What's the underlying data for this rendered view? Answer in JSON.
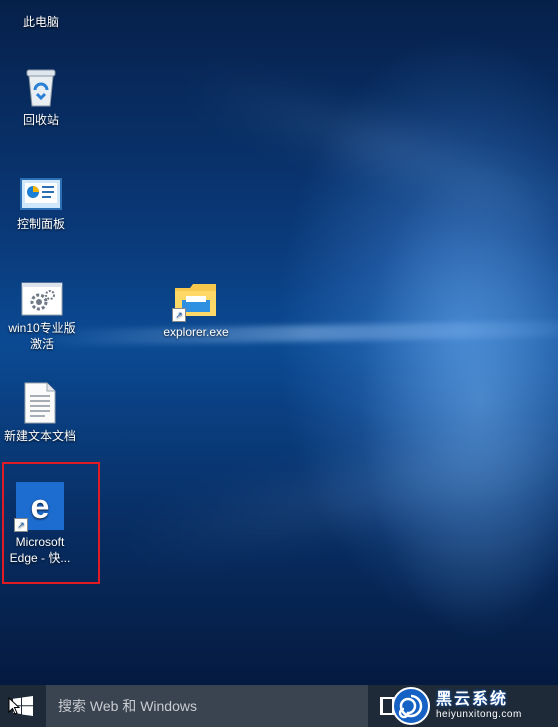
{
  "desktop": {
    "icons": [
      {
        "name": "this-pc",
        "label": "此电脑"
      },
      {
        "name": "recycle-bin",
        "label": "回收站"
      },
      {
        "name": "control-panel",
        "label": "控制面板"
      },
      {
        "name": "win10-activation",
        "label": "win10专业版\n激活"
      },
      {
        "name": "new-text-document",
        "label": "新建文本文档"
      },
      {
        "name": "microsoft-edge",
        "label": "Microsoft\nEdge - 快..."
      },
      {
        "name": "explorer-exe",
        "label": "explorer.exe"
      }
    ]
  },
  "taskbar": {
    "search_placeholder": "搜索 Web 和 Windows"
  },
  "watermark": {
    "title": "黑云系统",
    "url": "heiyunxitong.com"
  },
  "colors": {
    "highlight": "#e01b24",
    "taskbar": "#1e2a38",
    "edge_blue": "#1d6ccf"
  }
}
